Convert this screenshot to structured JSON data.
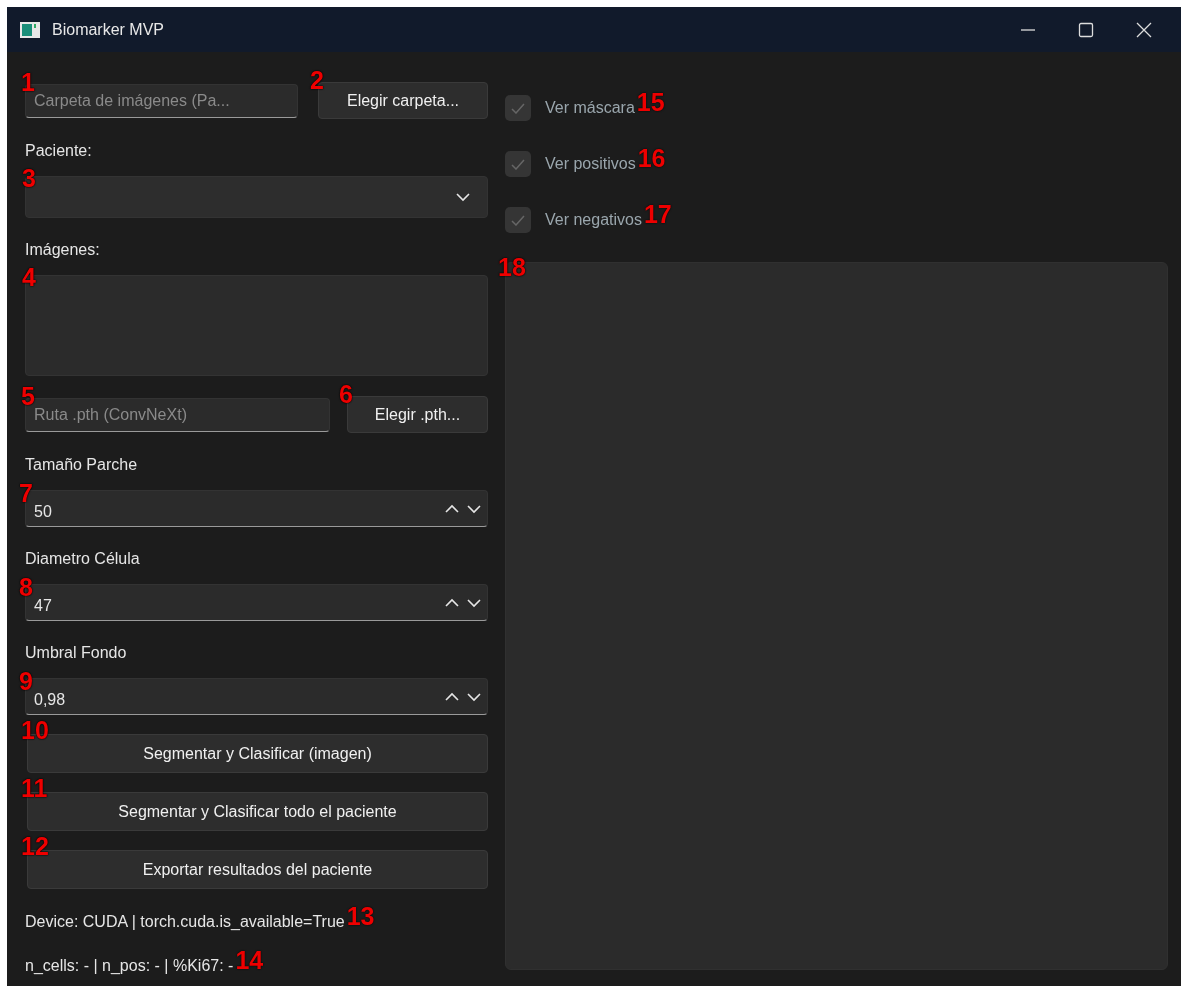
{
  "window": {
    "title": "Biomarker MVP"
  },
  "left_panel": [
    {
      "kind": "path_row",
      "field": {
        "placeholder": "Carpeta de imágenes (Pa...",
        "callout": "1"
      },
      "button": {
        "label": "Elegir carpeta...",
        "callout": "2"
      }
    },
    {
      "kind": "label",
      "text": "Paciente:"
    },
    {
      "kind": "combo",
      "callout": "3"
    },
    {
      "kind": "label",
      "text": "Imágenes:"
    },
    {
      "kind": "list",
      "callout": "4"
    },
    {
      "kind": "path_row",
      "field": {
        "placeholder": "Ruta .pth (ConvNeXt)",
        "callout": "5"
      },
      "button": {
        "label": "Elegir .pth...",
        "callout": "6"
      }
    },
    {
      "kind": "label",
      "text": "Tamaño Parche"
    },
    {
      "kind": "spin",
      "value": "50",
      "callout": "7"
    },
    {
      "kind": "label",
      "text": "Diametro Célula"
    },
    {
      "kind": "spin",
      "value": "47",
      "callout": "8"
    },
    {
      "kind": "label",
      "text": "Umbral Fondo"
    },
    {
      "kind": "spin",
      "value": "0,98",
      "callout": "9"
    },
    {
      "kind": "button",
      "label": "Segmentar y Clasificar (imagen)",
      "callout": "10"
    },
    {
      "kind": "button",
      "label": "Segmentar y Clasificar todo el paciente",
      "callout": "11"
    },
    {
      "kind": "button",
      "label": "Exportar resultados del paciente",
      "callout": "12"
    },
    {
      "kind": "status",
      "text": "Device: CUDA | torch.cuda.is_available=True",
      "callout": "13"
    },
    {
      "kind": "status",
      "text": "n_cells: - | n_pos: - | %Ki67: -",
      "callout": "14"
    }
  ],
  "right_panel": {
    "checkboxes": [
      {
        "label": "Ver máscara",
        "checked": true,
        "disabled": true,
        "callout": "15"
      },
      {
        "label": "Ver positivos",
        "checked": true,
        "disabled": true,
        "callout": "16"
      },
      {
        "label": "Ver negativos",
        "checked": true,
        "disabled": true,
        "callout": "17"
      }
    ],
    "image_view": {
      "callout": "18"
    }
  }
}
